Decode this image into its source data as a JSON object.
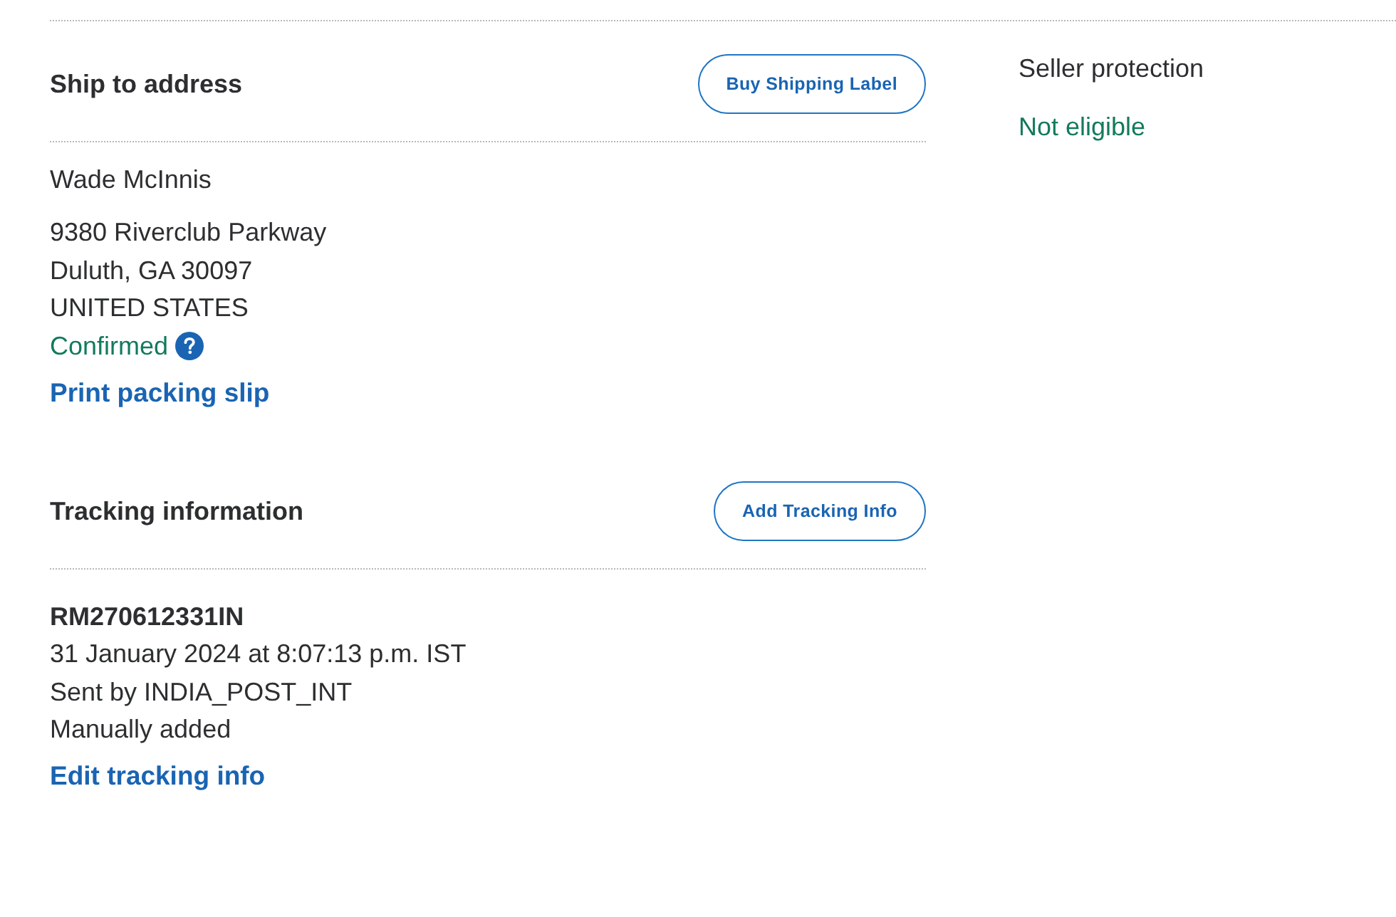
{
  "ship_to_address": {
    "title": "Ship to address",
    "button": "Buy Shipping Label",
    "name": "Wade McInnis",
    "address_lines": [
      "9380 Riverclub Parkway",
      "Duluth, GA 30097",
      "UNITED STATES"
    ],
    "status": {
      "text": "Confirmed",
      "help": true
    },
    "link": "Print packing slip"
  },
  "tracking_information": {
    "title": "Tracking information",
    "button": "Add Tracking Info",
    "number": "RM270612331IN",
    "details": [
      "31 January 2024 at 8:07:13 p.m. IST",
      "Sent by INDIA_POST_INT",
      "Manually added"
    ],
    "link": "Edit tracking info"
  },
  "seller_protection": {
    "title": "Seller protection",
    "status": "Not eligible"
  }
}
